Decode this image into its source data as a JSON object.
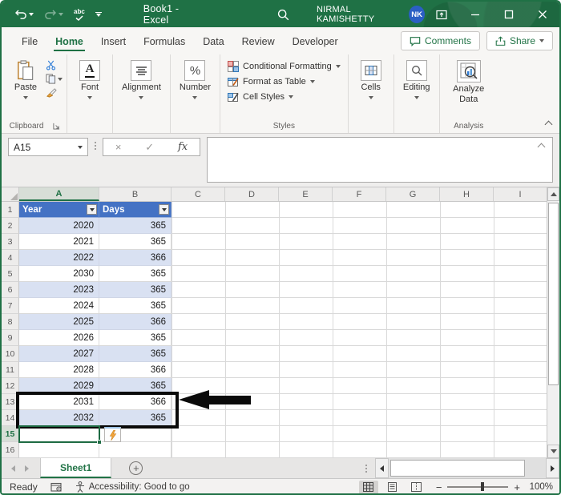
{
  "titlebar": {
    "title": "Book1 - Excel",
    "user_name": "NIRMAL KAMISHETTY",
    "avatar_initials": "NK"
  },
  "icons": {
    "spellcheck_text": "abc"
  },
  "ribbon": {
    "tabs": [
      {
        "label": "File",
        "active": false
      },
      {
        "label": "Home",
        "active": true
      },
      {
        "label": "Insert",
        "active": false
      },
      {
        "label": "Formulas",
        "active": false
      },
      {
        "label": "Data",
        "active": false
      },
      {
        "label": "Review",
        "active": false
      },
      {
        "label": "Developer",
        "active": false
      }
    ],
    "comments_label": "Comments",
    "share_label": "Share",
    "groups": {
      "clipboard": {
        "label": "Clipboard",
        "paste_label": "Paste"
      },
      "font": {
        "label": "Font",
        "icon_letter": "A"
      },
      "alignment": {
        "label": "Alignment"
      },
      "number": {
        "label": "Number",
        "icon_text": "%"
      },
      "styles": {
        "label": "Styles",
        "items": [
          "Conditional Formatting",
          "Format as Table",
          "Cell Styles"
        ]
      },
      "cells": {
        "label": "Cells"
      },
      "editing": {
        "label": "Editing"
      },
      "analysis": {
        "label": "Analysis",
        "button_label": "Analyze Data"
      }
    }
  },
  "formula_bar": {
    "name_box_value": "A15",
    "cancel_glyph": "×",
    "enter_glyph": "✓",
    "fx_label": "fx"
  },
  "grid": {
    "column_headers": [
      "A",
      "B",
      "C",
      "D",
      "E",
      "F",
      "G",
      "H",
      "I"
    ],
    "active_column": "A",
    "active_row": "15",
    "active_cell": "A15",
    "row_numbers": [
      "1",
      "2",
      "3",
      "4",
      "5",
      "6",
      "7",
      "8",
      "9",
      "10",
      "11",
      "12",
      "13",
      "14",
      "15",
      "16"
    ],
    "table": {
      "headers": [
        "Year",
        "Days"
      ],
      "header_fill": "#4472C4",
      "band_fill": "#D9E1F2",
      "rows": [
        {
          "year": "2020",
          "days": "365"
        },
        {
          "year": "2021",
          "days": "365"
        },
        {
          "year": "2022",
          "days": "366"
        },
        {
          "year": "2030",
          "days": "365"
        },
        {
          "year": "2023",
          "days": "365"
        },
        {
          "year": "2024",
          "days": "365"
        },
        {
          "year": "2025",
          "days": "366"
        },
        {
          "year": "2026",
          "days": "365"
        },
        {
          "year": "2027",
          "days": "365"
        },
        {
          "year": "2028",
          "days": "366"
        },
        {
          "year": "2029",
          "days": "365"
        },
        {
          "year": "2031",
          "days": "366"
        },
        {
          "year": "2032",
          "days": "365"
        }
      ]
    },
    "highlight_range": "A13:B14"
  },
  "sheet_bar": {
    "active_tab": "Sheet1",
    "new_sheet_glyph": "+"
  },
  "status_bar": {
    "mode": "Ready",
    "accessibility": "Accessibility: Good to go",
    "zoom_minus": "−",
    "zoom_plus": "+",
    "zoom_level": "100%"
  }
}
